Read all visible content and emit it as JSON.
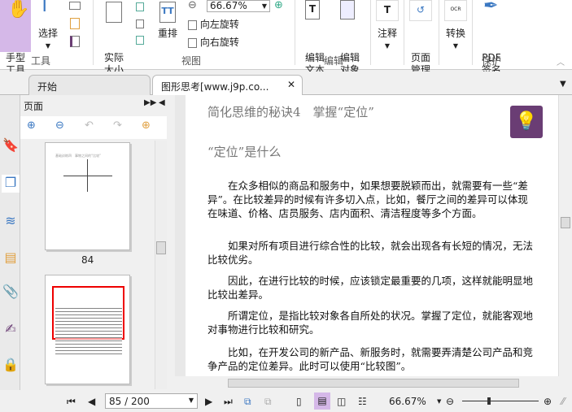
{
  "ribbon": {
    "hand_tool": "手型\n工具",
    "select": "选择",
    "actual_size": "实际\n大小",
    "reflow": "重排",
    "zoom_value": "66.67%",
    "rotate_left": "向左旋转",
    "rotate_right": "向右旋转",
    "edit_text": "编辑\n文本",
    "edit_object": "编辑\n对象",
    "annotate": "注释",
    "page_manage": "页面\n管理",
    "convert": "转换",
    "pdf_sign": "PDF\n签名",
    "groups": {
      "tools": "工具",
      "view": "视图",
      "edit": "编辑",
      "protect": "保护"
    }
  },
  "tabs": [
    {
      "label": "开始"
    },
    {
      "label": "图形思考[www.j9p.co..."
    }
  ],
  "panel": {
    "title": "页面",
    "thumb1_title": "基础训练四　事物之间的“比较”",
    "thumb1_page": "84"
  },
  "document": {
    "heading": "简化思维的秘诀4　掌握“定位”",
    "subheading": "“定位”是什么",
    "paragraphs": [
      "在众多相似的商品和服务中，如果想要脱颖而出，就需要有一些“差异”。在比较差异的时候有许多切入点，比如，餐厅之间的差异可以体现在味道、价格、店员服务、店内面积、清洁程度等多个方面。",
      "如果对所有项目进行综合性的比较，就会出现各有长短的情况，无法比较优劣。",
      "因此，在进行比较的时候，应该锁定最重要的几项，这样就能明显地比较出差异。",
      "所谓定位，是指比较对象各自所处的状况。掌握了定位，就能客观地对事物进行比较和研究。",
      "比如，在开发公司的新产品、新服务时，就需要弄清楚公司产品和竞争产品的定位差异。此时可以使用“比较图”。"
    ]
  },
  "status": {
    "page_input": "85 / 200",
    "zoom": "66.67%",
    "zoom_fraction": 0.33
  },
  "colors": {
    "accent": "#d5b8e8",
    "bulb_bg": "#6a3d74"
  }
}
